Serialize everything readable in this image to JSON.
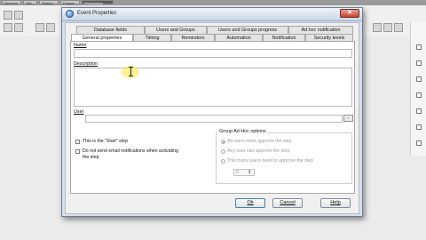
{
  "background": {
    "tabs": [
      "Records",
      "Site",
      "Search",
      "Project",
      "Workstation"
    ],
    "active_tab_index": 4
  },
  "dialog": {
    "title": "Event Properties",
    "close_label": "✕",
    "tabs_row1": [
      "Database fields",
      "Users and Groups",
      "Users and Groups progress",
      "Ad hoc notification"
    ],
    "tabs_row2": [
      "General properties",
      "Timing",
      "Reminders",
      "Automation",
      "Notification",
      "Security levels"
    ],
    "active_tab": "General properties",
    "fields": {
      "name_label": "Name",
      "description_label": "Description",
      "user_label": "User",
      "browse_label": "..."
    },
    "checks": {
      "start_step": "This is the \"Start\" step",
      "no_email_line1": "Do not send email notifications when activating",
      "no_email_line2": "the step"
    },
    "group": {
      "title": "Group Ad Hoc options",
      "options": [
        "All users must approve the step",
        "Any user can approve the step",
        "This many users need to approve the step"
      ],
      "selected_index": 0,
      "count_value": "0"
    },
    "buttons": {
      "ok": "Ok",
      "cancel": "Cancel",
      "help": "Help"
    }
  }
}
